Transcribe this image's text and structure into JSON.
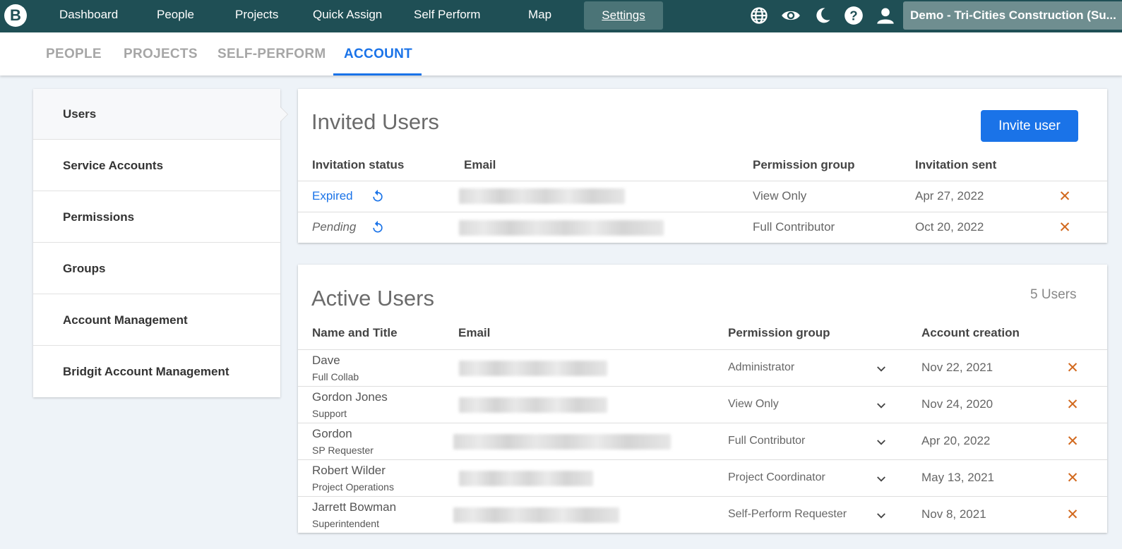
{
  "topbar": {
    "logo_letter": "B",
    "nav": [
      "Dashboard",
      "People",
      "Projects",
      "Quick Assign",
      "Self Perform",
      "Map"
    ],
    "active_nav": "Settings",
    "icons": [
      "globe-icon",
      "eye-icon",
      "moon-icon",
      "help-icon",
      "user-icon"
    ],
    "account_label": "Demo - Tri-Cities Construction (Su..."
  },
  "subtabs": [
    "PEOPLE",
    "PROJECTS",
    "SELF-PERFORM",
    "ACCOUNT"
  ],
  "active_subtab": "ACCOUNT",
  "sidebar": {
    "items": [
      "Users",
      "Service Accounts",
      "Permissions",
      "Groups",
      "Account Management",
      "Bridgit Account Management"
    ],
    "active": "Users"
  },
  "invited": {
    "title": "Invited Users",
    "invite_button": "Invite user",
    "headers": [
      "Invitation status",
      "Email",
      "Permission group",
      "Invitation sent"
    ],
    "rows": [
      {
        "status": "Expired",
        "permission": "View Only",
        "sent": "Apr 27, 2022"
      },
      {
        "status": "Pending",
        "permission": "Full Contributor",
        "sent": "Oct 20, 2022"
      }
    ]
  },
  "active": {
    "title": "Active Users",
    "count": "5 Users",
    "headers": [
      "Name and Title",
      "Email",
      "Permission group",
      "Account creation"
    ],
    "rows": [
      {
        "name": "Dave",
        "title": "Full Collab",
        "permission": "Administrator",
        "created": "Nov 22, 2021"
      },
      {
        "name": "Gordon Jones",
        "title": "Support",
        "permission": "View Only",
        "created": "Nov 24, 2020"
      },
      {
        "name": "Gordon",
        "title": "SP Requester",
        "permission": "Full Contributor",
        "created": "Apr 20, 2022"
      },
      {
        "name": "Robert Wilder",
        "title": "Project Operations",
        "permission": "Project Coordinator",
        "created": "May 13, 2021"
      },
      {
        "name": "Jarrett Bowman",
        "title": "Superintendent",
        "permission": "Self-Perform Requester",
        "created": "Nov 8, 2021"
      }
    ]
  },
  "colors": {
    "topbar": "#1f4f55",
    "accent": "#1a73e8",
    "remove": "#d2691e"
  }
}
